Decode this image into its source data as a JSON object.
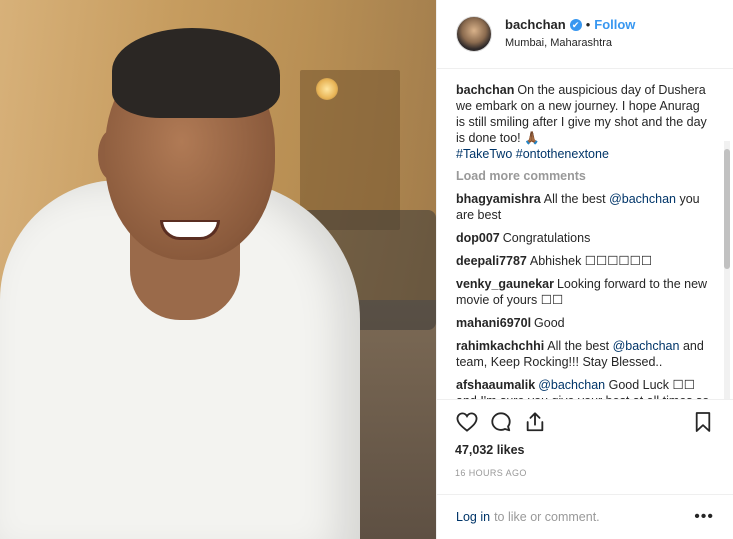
{
  "header": {
    "username": "bachchan",
    "verified_icon": "✔",
    "separator": "•",
    "follow_label": "Follow",
    "location": "Mumbai, Maharashtra"
  },
  "caption": {
    "username": "bachchan",
    "text": "On the auspicious day of Dushera we embark on a new journey. I hope Anurag is still smiling after I give my shot and the day is done too! 🙏🏾 ",
    "hashtags": "#TakeTwo #ontothenextone"
  },
  "load_more_label": "Load more comments",
  "comments": [
    {
      "username": "bhagyamishra",
      "pre": "All the best ",
      "mention": "@bachchan",
      "post": " you are best"
    },
    {
      "username": "dop007",
      "pre": "Congratulations",
      "mention": "",
      "post": ""
    },
    {
      "username": "deepali7787",
      "pre": "Abhishek ☐☐☐☐☐☐",
      "mention": "",
      "post": ""
    },
    {
      "username": "venky_gaunekar",
      "pre": "Looking forward to the new movie of yours ☐☐",
      "mention": "",
      "post": ""
    },
    {
      "username": "mahani6970l",
      "pre": "Good",
      "mention": "",
      "post": ""
    },
    {
      "username": "rahimkachchhi",
      "pre": "All the best ",
      "mention": "@bachchan",
      "post": " and team, Keep Rocking!!! Stay Blessed.."
    },
    {
      "username": "afshaaumalik",
      "pre": "",
      "mention": "@bachchan",
      "post": " Good Luck ☐☐ and I'm sure you give your best at all times so I'm sure Anurag Saab will be smiling if"
    }
  ],
  "actions": {
    "like_icon": "heart-icon",
    "comment_icon": "comment-icon",
    "share_icon": "share-icon",
    "save_icon": "bookmark-icon"
  },
  "likes": "47,032 likes",
  "timestamp": "16 HOURS AGO",
  "footer": {
    "login_label": "Log in",
    "text": "to like or comment.",
    "more_label": "•••"
  },
  "colors": {
    "link_blue": "#3897f0",
    "dark_link": "#003569",
    "muted": "#999999"
  }
}
